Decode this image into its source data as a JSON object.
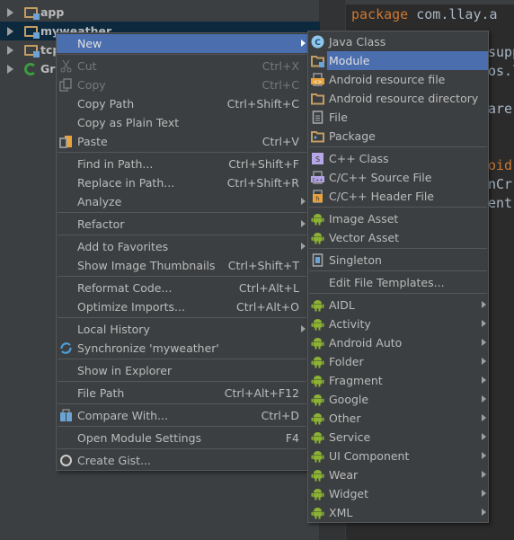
{
  "tree": {
    "items": [
      {
        "label": "app",
        "icon": "module-folder-icon"
      },
      {
        "label": "myweather",
        "icon": "module-folder-icon",
        "selected": true
      },
      {
        "label": "tcp",
        "icon": "module-folder-icon"
      },
      {
        "label": "Gra",
        "icon": "gradle-icon"
      }
    ]
  },
  "editor": {
    "lines": [
      {
        "kw": "package",
        "text": " com.llay.a"
      },
      {
        "kw": "",
        "text": "supp"
      },
      {
        "kw": "",
        "text": "os.l"
      },
      {
        "kw": "",
        "text": "are"
      },
      {
        "kw": "oid",
        "text": ""
      },
      {
        "kw": "",
        "text": "nCr"
      },
      {
        "kw": "",
        "text": "ent"
      }
    ]
  },
  "context_menu": {
    "items": [
      {
        "label": "New",
        "submenu": true,
        "highlighted": true
      },
      {
        "sep": true
      },
      {
        "label": "Cut",
        "shortcut": "Ctrl+X",
        "icon": "scissors-icon",
        "disabled": true
      },
      {
        "label": "Copy",
        "shortcut": "Ctrl+C",
        "icon": "copy-icon",
        "disabled": true
      },
      {
        "label": "Copy Path",
        "shortcut": "Ctrl+Shift+C"
      },
      {
        "label": "Copy as Plain Text"
      },
      {
        "label": "Paste",
        "shortcut": "Ctrl+V",
        "icon": "paste-icon"
      },
      {
        "sep": true
      },
      {
        "label": "Find in Path...",
        "shortcut": "Ctrl+Shift+F"
      },
      {
        "label": "Replace in Path...",
        "shortcut": "Ctrl+Shift+R"
      },
      {
        "label": "Analyze",
        "submenu": true
      },
      {
        "sep": true
      },
      {
        "label": "Refactor",
        "submenu": true
      },
      {
        "sep": true
      },
      {
        "label": "Add to Favorites",
        "submenu": true
      },
      {
        "label": "Show Image Thumbnails",
        "shortcut": "Ctrl+Shift+T"
      },
      {
        "sep": true
      },
      {
        "label": "Reformat Code...",
        "shortcut": "Ctrl+Alt+L"
      },
      {
        "label": "Optimize Imports...",
        "shortcut": "Ctrl+Alt+O"
      },
      {
        "sep": true
      },
      {
        "label": "Local History",
        "submenu": true
      },
      {
        "label": "Synchronize 'myweather'",
        "icon": "sync-icon"
      },
      {
        "sep": true
      },
      {
        "label": "Show in Explorer"
      },
      {
        "sep": true
      },
      {
        "label": "File Path",
        "shortcut": "Ctrl+Alt+F12"
      },
      {
        "sep": true
      },
      {
        "label": "Compare With...",
        "shortcut": "Ctrl+D",
        "icon": "compare-icon"
      },
      {
        "sep": true
      },
      {
        "label": "Open Module Settings",
        "shortcut": "F4"
      },
      {
        "sep": true
      },
      {
        "label": "Create Gist...",
        "icon": "github-icon"
      }
    ]
  },
  "new_submenu": {
    "items": [
      {
        "label": "Java Class",
        "icon": "java-class-icon"
      },
      {
        "label": "Module",
        "icon": "module-folder-icon",
        "highlighted": true
      },
      {
        "label": "Android resource file",
        "icon": "android-resource-file-icon"
      },
      {
        "label": "Android resource directory",
        "icon": "folder-icon"
      },
      {
        "label": "File",
        "icon": "file-icon"
      },
      {
        "label": "Package",
        "icon": "package-icon"
      },
      {
        "sep": true
      },
      {
        "label": "C++ Class",
        "icon": "cpp-class-icon"
      },
      {
        "label": "C/C++ Source File",
        "icon": "cpp-source-icon"
      },
      {
        "label": "C/C++ Header File",
        "icon": "cpp-header-icon"
      },
      {
        "sep": true
      },
      {
        "label": "Image Asset",
        "icon": "android-icon"
      },
      {
        "label": "Vector Asset",
        "icon": "android-icon"
      },
      {
        "sep": true
      },
      {
        "label": "Singleton",
        "icon": "singleton-icon"
      },
      {
        "sep": true
      },
      {
        "label": "Edit File Templates..."
      },
      {
        "sep": true
      },
      {
        "label": "AIDL",
        "icon": "android-icon",
        "submenu": true
      },
      {
        "label": "Activity",
        "icon": "android-icon",
        "submenu": true
      },
      {
        "label": "Android Auto",
        "icon": "android-icon",
        "submenu": true
      },
      {
        "label": "Folder",
        "icon": "android-icon",
        "submenu": true
      },
      {
        "label": "Fragment",
        "icon": "android-icon",
        "submenu": true
      },
      {
        "label": "Google",
        "icon": "android-icon",
        "submenu": true
      },
      {
        "label": "Other",
        "icon": "android-icon",
        "submenu": true
      },
      {
        "label": "Service",
        "icon": "android-icon",
        "submenu": true
      },
      {
        "label": "UI Component",
        "icon": "android-icon",
        "submenu": true
      },
      {
        "label": "Wear",
        "icon": "android-icon",
        "submenu": true
      },
      {
        "label": "Widget",
        "icon": "android-icon",
        "submenu": true
      },
      {
        "label": "XML",
        "icon": "android-icon",
        "submenu": true
      }
    ]
  },
  "colors": {
    "highlight": "#4b6eaf",
    "menu_bg": "#3c3f41",
    "selection": "#0d293e",
    "android_green": "#8bb233",
    "keyword": "#cc7832"
  }
}
